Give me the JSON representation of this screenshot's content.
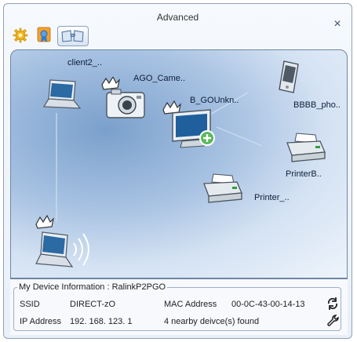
{
  "window": {
    "title": "Advanced",
    "close_glyph": "×"
  },
  "toolbar": {
    "items": [
      {
        "name": "settings",
        "icon": "gear-icon"
      },
      {
        "name": "profile",
        "icon": "certificate-icon"
      },
      {
        "name": "wifi-direct",
        "icon": "wireless-cards-icon",
        "selected": true
      }
    ]
  },
  "devices": [
    {
      "label": "client2_..",
      "type": "laptop"
    },
    {
      "label": "AGO_Came..",
      "type": "camera"
    },
    {
      "label": "B_GOUnkn..",
      "type": "monitor"
    },
    {
      "label": "BBBB_pho..",
      "type": "phone"
    },
    {
      "label": "PrinterB..",
      "type": "printer"
    },
    {
      "label": "Printer_..",
      "type": "printer"
    }
  ],
  "info": {
    "legend": "My Device Information : RalinkP2PGO",
    "ssid_label": "SSID",
    "ssid_value": "DIRECT-zO",
    "mac_label": "MAC Address",
    "mac_value": "00-0C-43-00-14-13",
    "ip_label": "IP Address",
    "ip_value": "192. 168. 123. 1",
    "nearby_text": "4 nearby deivce(s) found"
  },
  "colors": {
    "accent": "#3a6ea5",
    "map_dark": "#7aa0cc",
    "map_light": "#eef4fb"
  }
}
